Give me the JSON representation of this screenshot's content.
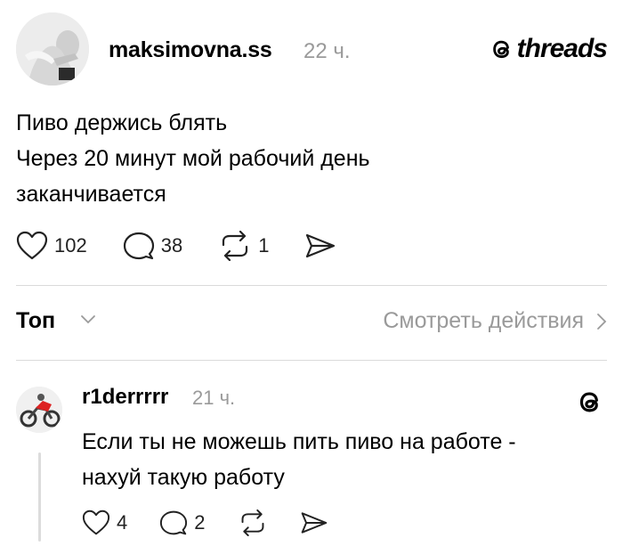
{
  "post": {
    "username": "maksimovna.ss",
    "time": "22 ч.",
    "brand_word": "threads",
    "lines": [
      "Пиво держись блять",
      "Через 20 минут мой рабочий день",
      "заканчивается"
    ],
    "likes": "102",
    "comments": "38",
    "reposts": "1"
  },
  "sort": {
    "label": "Топ",
    "view_activity": "Смотреть действия"
  },
  "reply": {
    "username": "r1derrrrr",
    "time": "21 ч.",
    "lines": [
      "Если ты не можешь пить пиво на работе -",
      "нахуй такую работу"
    ],
    "likes": "4",
    "comments": "2"
  },
  "icons": {
    "like": "heart-icon",
    "comment": "comment-bubble-icon",
    "repost": "repost-icon",
    "share": "send-icon",
    "brand": "threads-logo-icon",
    "chevron_down": "chevron-down-icon",
    "chevron_right": "chevron-right-icon"
  },
  "colors": {
    "text": "#000000",
    "muted": "#9a9a9a",
    "divider": "#dadada"
  }
}
